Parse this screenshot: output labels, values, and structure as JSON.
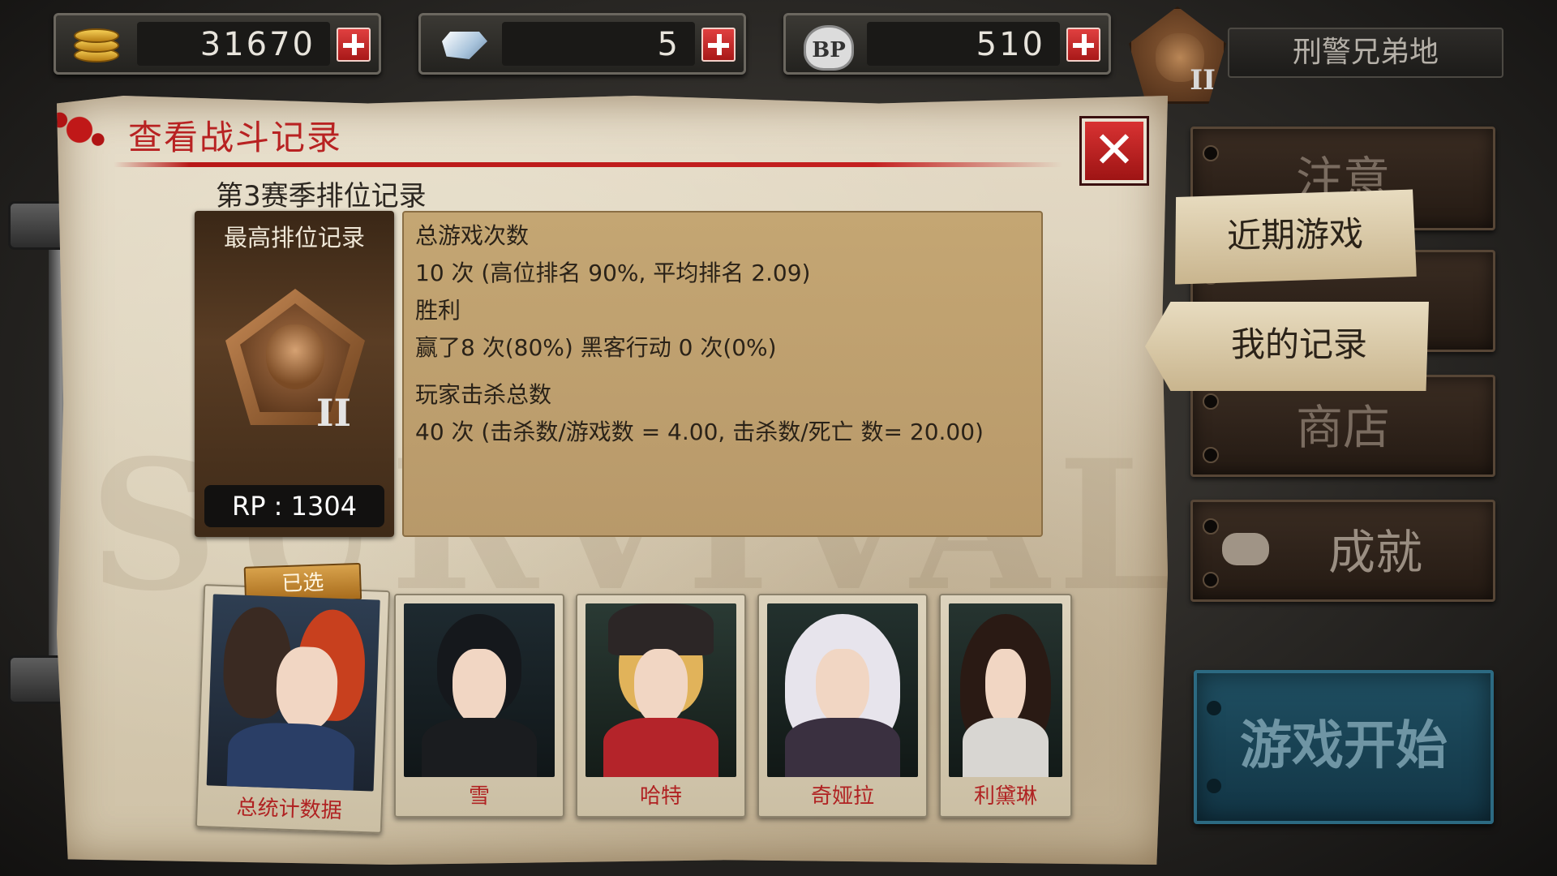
{
  "currency": {
    "gold": "31670",
    "diamond": "5",
    "bp": "510",
    "bp_icon_text": "BP"
  },
  "player": {
    "name": "刑警兄弟地",
    "rank_roman": "II"
  },
  "panel": {
    "title": "查看战斗记录",
    "season_title": "第3赛季排位记录",
    "watermark": "SURVIVAL GAMES",
    "best_rank": {
      "label": "最高排位记录",
      "roman": "II",
      "rp": "RP : 1304"
    },
    "stats": {
      "games_head": "总游戏次数",
      "games_value": "10 次 (高位排名 90%, 平均排名 2.09)",
      "wins_head": "胜利",
      "wins_value": "赢了8 次(80%) 黑客行动 0 次(0%)",
      "kills_head": "玩家击杀总数",
      "kills_value": "40 次 (击杀数/游戏数 = 4.00, 击杀数/死亡 数= 20.00)"
    },
    "selected_badge": "已选",
    "characters": [
      {
        "name": "总统计数据"
      },
      {
        "name": "雪"
      },
      {
        "name": "哈特"
      },
      {
        "name": "奇娅拉"
      },
      {
        "name": "利黛琳"
      }
    ]
  },
  "menu": {
    "notice": "注意",
    "recent_games": "近期游戏",
    "my_records": "我的记录",
    "shop": "商店",
    "achievements": "成就",
    "start": "游戏开始"
  },
  "colors": {
    "accent_red": "#b82222",
    "start_blue": "#1f4f62"
  }
}
